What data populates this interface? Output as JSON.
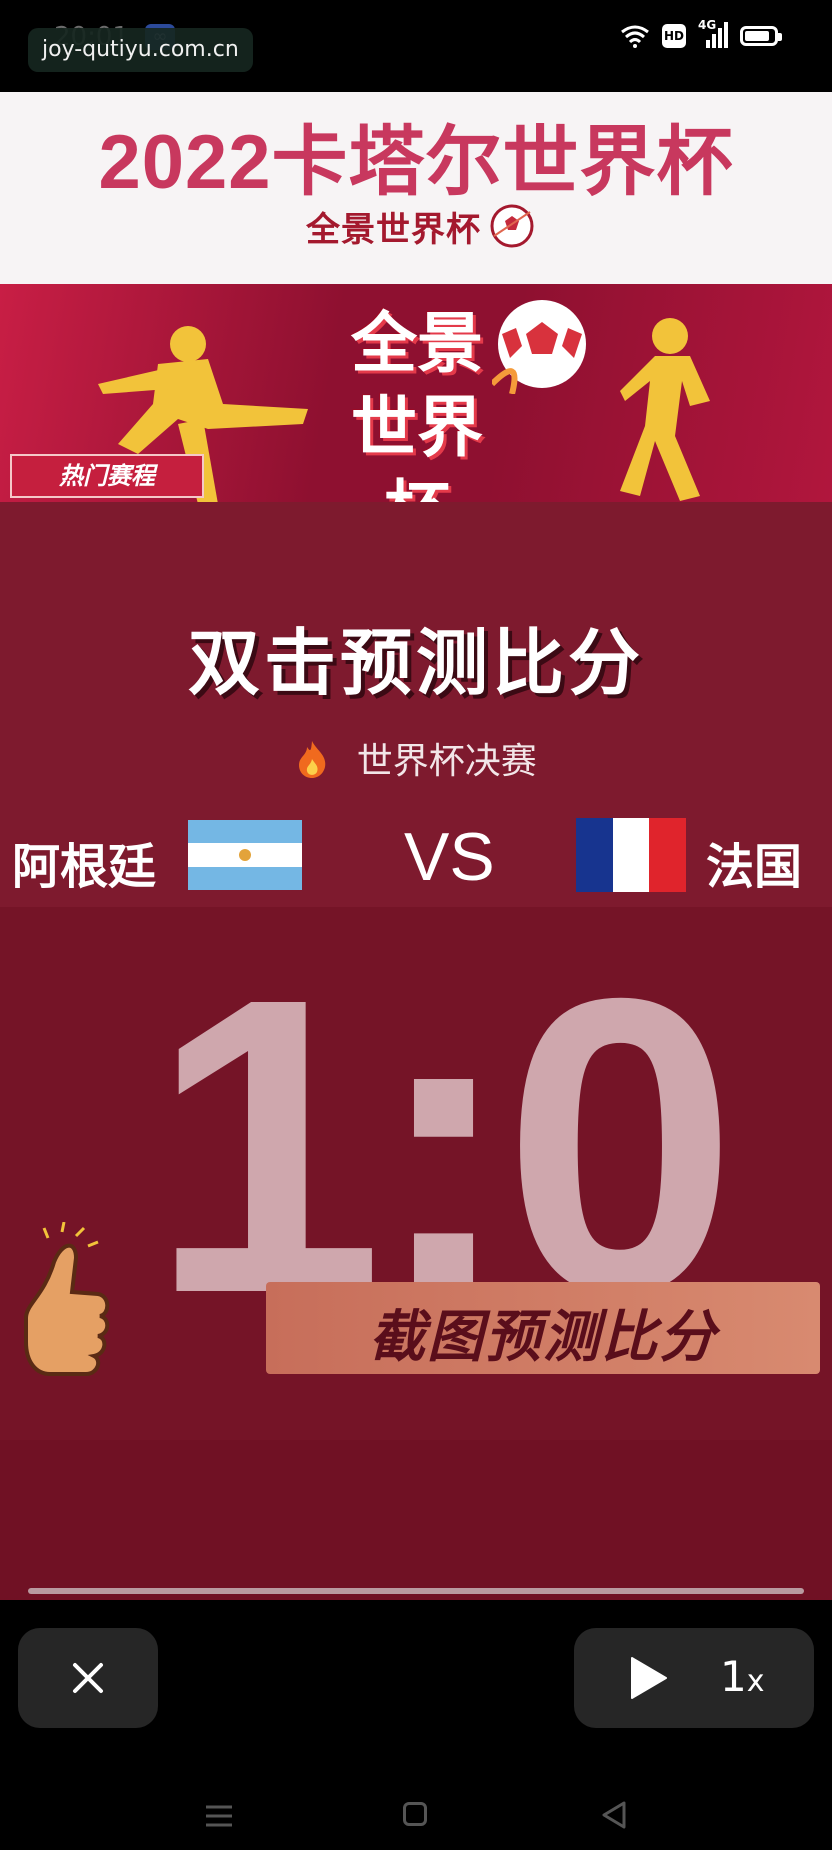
{
  "status_bar": {
    "time": "20:01",
    "infinity_badge": "∞",
    "watermark": "joy-qutiyu.com.cn",
    "hd_badge": "HD",
    "network_label": "4G",
    "icons": [
      "wifi-icon",
      "hd-icon",
      "signal-icon",
      "battery-icon"
    ]
  },
  "video": {
    "main_title": "2022卡塔尔世界杯",
    "logo_small": "全景世界杯",
    "banner": {
      "logo_line1": "全景",
      "logo_line2": "世界杯",
      "tag": "热门赛程"
    },
    "headline": "双击预测比分",
    "subline": "世界杯决赛",
    "match": {
      "team_left": "阿根廷",
      "vs": "VS",
      "team_right": "法国",
      "score": "1:0"
    },
    "cta": "截图预测比分",
    "colors": {
      "title": "#c8385e",
      "background": "#7e1a2e",
      "score": "#cfa7ad",
      "cta_bg": "#d07c66"
    }
  },
  "player_controls": {
    "close_icon": "close-icon",
    "play_icon": "play-icon",
    "speed": "1",
    "speed_suffix": "x"
  },
  "nav_bar": {
    "icons": [
      "menu-icon",
      "home-icon",
      "back-icon"
    ]
  }
}
